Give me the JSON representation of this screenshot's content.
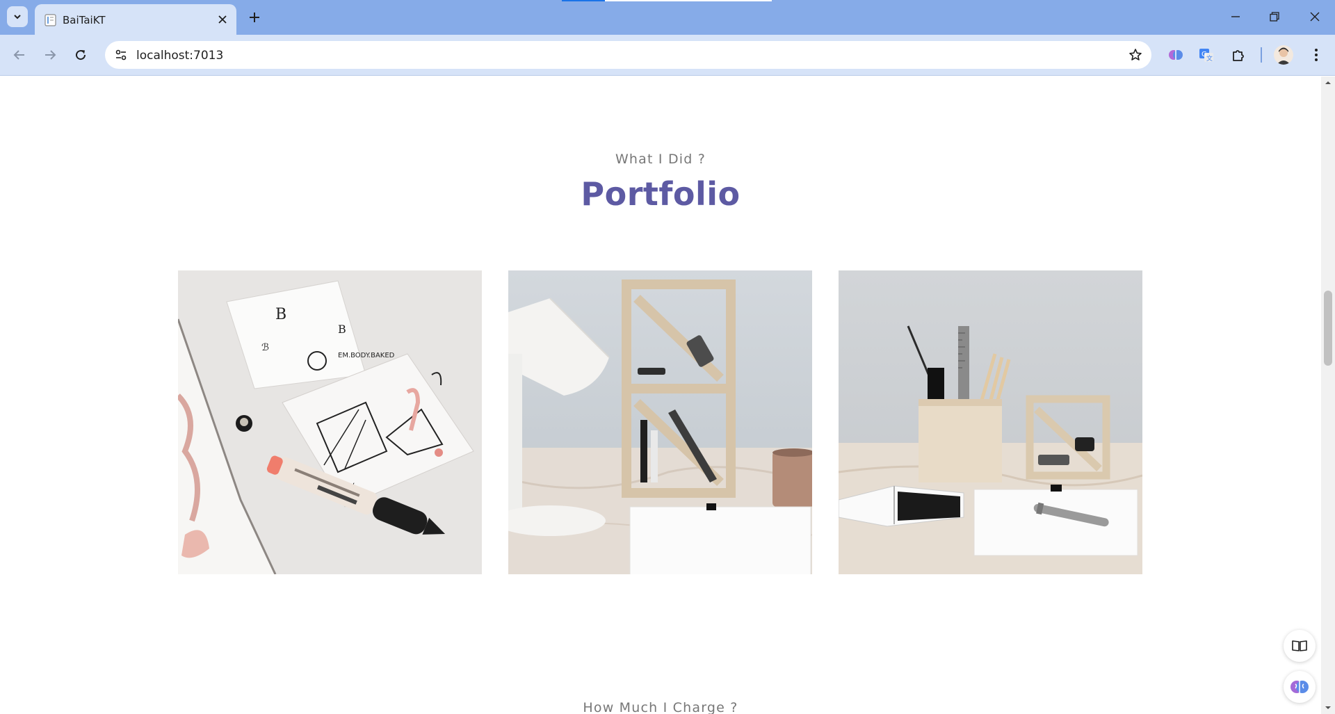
{
  "browser": {
    "tab_title": "BaiTaiKT",
    "url": "localhost:7013",
    "icons": {
      "tab_list": "chevron-down-icon",
      "tab_close": "close-icon",
      "new_tab": "plus-icon",
      "back": "arrow-left-icon",
      "forward": "arrow-right-icon",
      "reload": "reload-icon",
      "site_info": "tune-icon",
      "bookmark": "star-icon",
      "extensions": "puzzle-icon",
      "menu": "kebab-menu-icon"
    },
    "colors": {
      "tabbar": "#86abe8",
      "toolbar": "#d6e3f8"
    }
  },
  "portfolio": {
    "eyebrow": "What I Did ?",
    "title": "Portfolio",
    "title_color": "#5d5aa3",
    "items": [
      {
        "subject": "sketchbook-drawings-marker"
      },
      {
        "subject": "desk-lamp-plywood-shelves"
      },
      {
        "subject": "plywood-pencil-holder-notebook"
      }
    ]
  },
  "pricing": {
    "eyebrow": "How Much I Charge ?"
  },
  "floating": {
    "reader_mode_icon": "book-open-icon",
    "assistant_icon": "brain-icon"
  }
}
